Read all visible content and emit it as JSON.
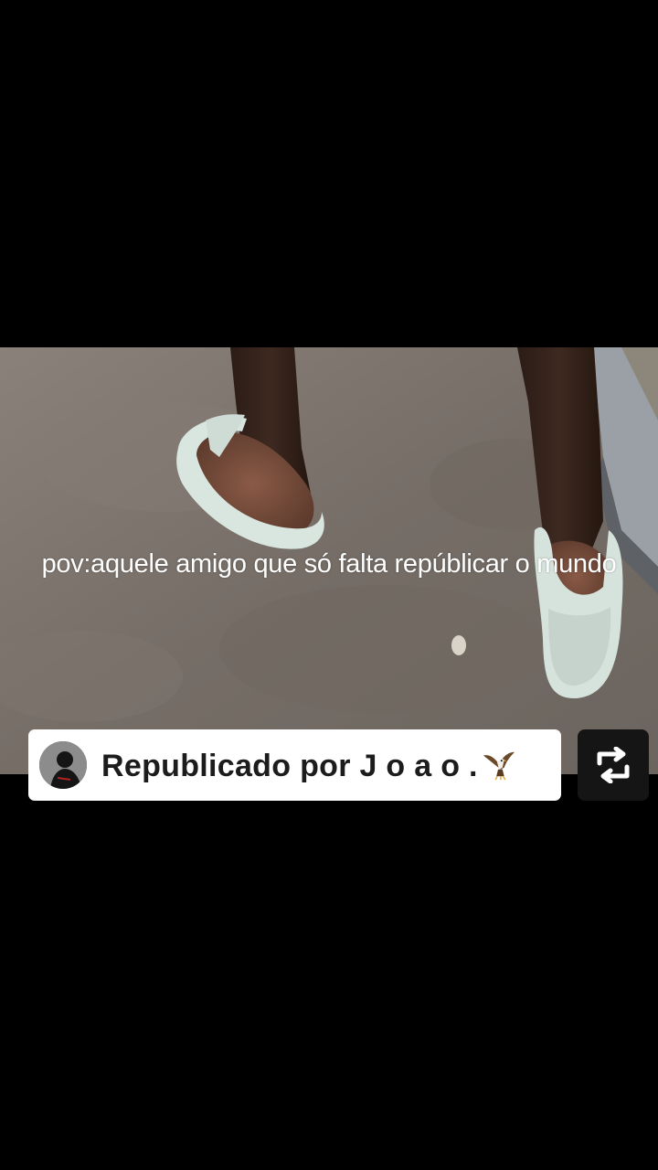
{
  "video": {
    "caption": "pov:aquele amigo que só falta repúblicar o mundo"
  },
  "repost_banner": {
    "label": "Republicado por J o a o ."
  },
  "icons": {
    "avatar": "user-avatar-icon",
    "eagle": "eagle-emoji-icon",
    "repost": "repost-icon"
  },
  "colors": {
    "background": "#000000",
    "banner_background": "#ffffff",
    "banner_text": "#1c1c1c",
    "repost_button_bg": "#151515"
  }
}
